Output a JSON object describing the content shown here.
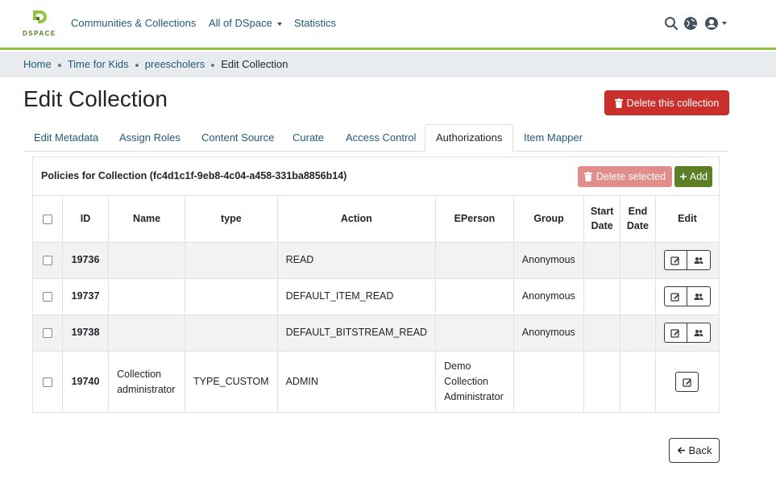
{
  "header": {
    "logo_text": "DSPACE",
    "nav": [
      "Communities & Collections",
      "All of DSpace",
      "Statistics"
    ],
    "icons": [
      "search-icon",
      "globe-icon",
      "user-icon"
    ],
    "accent_color": "#92c642"
  },
  "breadcrumb": [
    "Home",
    "Time for Kids",
    "preescholers",
    "Edit Collection"
  ],
  "page_title": "Edit Collection",
  "delete_collection_label": "Delete this collection",
  "tabs": [
    "Edit Metadata",
    "Assign Roles",
    "Content Source",
    "Curate",
    "Access Control",
    "Authorizations",
    "Item Mapper"
  ],
  "active_tab": "Authorizations",
  "policies": {
    "title": "Policies for Collection (fc4d1c1f-9eb8-4c04-a458-331ba8856b14)",
    "delete_selected_label": "Delete selected",
    "add_label": "Add",
    "columns": [
      "ID",
      "Name",
      "type",
      "Action",
      "EPerson",
      "Group",
      "Start Date",
      "End Date",
      "Edit"
    ],
    "rows": [
      {
        "id": "19736",
        "name": "",
        "type": "",
        "action": "READ",
        "eperson": "",
        "group": "Anonymous",
        "start": "",
        "end": ""
      },
      {
        "id": "19737",
        "name": "",
        "type": "",
        "action": "DEFAULT_ITEM_READ",
        "eperson": "",
        "group": "Anonymous",
        "start": "",
        "end": ""
      },
      {
        "id": "19738",
        "name": "",
        "type": "",
        "action": "DEFAULT_BITSTREAM_READ",
        "eperson": "",
        "group": "Anonymous",
        "start": "",
        "end": ""
      },
      {
        "id": "19740",
        "name": "Collection administrator",
        "type": "TYPE_CUSTOM",
        "action": "ADMIN",
        "eperson": "Demo Collection Administrator",
        "group": "",
        "start": "",
        "end": ""
      }
    ]
  },
  "back_label": "Back"
}
